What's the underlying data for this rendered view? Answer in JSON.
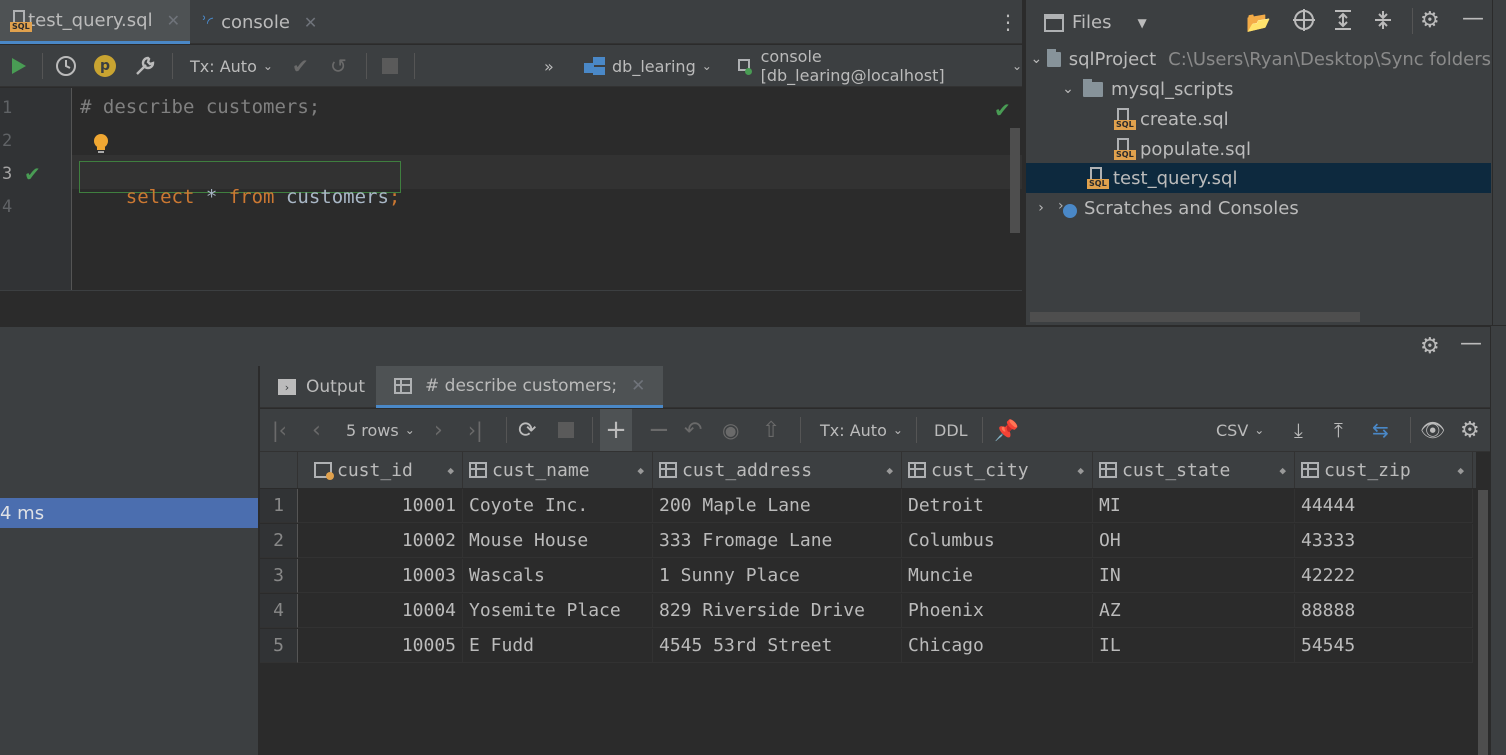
{
  "editor_tabs": [
    {
      "label": "test_query.sql",
      "active": true
    },
    {
      "label": "console",
      "active": false
    }
  ],
  "editor_toolbar": {
    "tx_mode": "Tx: Auto",
    "schema": "db_learing",
    "console": "console [db_learing@localhost]",
    "more": "»"
  },
  "editor": {
    "line_numbers": [
      "1",
      "2",
      "3",
      "4"
    ],
    "line1": "# describe customers;",
    "line3_keyword1": "select",
    "line3_star": " * ",
    "line3_keyword2": "from",
    "line3_table": " customers",
    "line3_semicolon": ";"
  },
  "project": {
    "view_label": "Files",
    "tree": {
      "root": "sqlProject",
      "root_path": "C:\\Users\\Ryan\\Desktop\\Sync folders",
      "folder": "mysql_scripts",
      "file1": "create.sql",
      "file2": "populate.sql",
      "file3": "test_query.sql",
      "scratches": "Scratches and Consoles"
    }
  },
  "services": {
    "left_item": "4 ms",
    "tabs": [
      {
        "label": "Output"
      },
      {
        "label": "# describe customers;"
      }
    ]
  },
  "result_toolbar": {
    "rows": "5 rows",
    "tx_mode": "Tx: Auto",
    "ddl": "DDL",
    "export_format": "CSV"
  },
  "grid": {
    "columns": [
      "cust_id",
      "cust_name",
      "cust_address",
      "cust_city",
      "cust_state",
      "cust_zip"
    ],
    "rows": [
      {
        "n": "1",
        "cust_id": "10001",
        "cust_name": "Coyote Inc.",
        "cust_address": "200 Maple Lane",
        "cust_city": "Detroit",
        "cust_state": "MI",
        "cust_zip": "44444"
      },
      {
        "n": "2",
        "cust_id": "10002",
        "cust_name": "Mouse House",
        "cust_address": "333 Fromage Lane",
        "cust_city": "Columbus",
        "cust_state": "OH",
        "cust_zip": "43333"
      },
      {
        "n": "3",
        "cust_id": "10003",
        "cust_name": "Wascals",
        "cust_address": "1 Sunny Place",
        "cust_city": "Muncie",
        "cust_state": "IN",
        "cust_zip": "42222"
      },
      {
        "n": "4",
        "cust_id": "10004",
        "cust_name": "Yosemite Place",
        "cust_address": "829 Riverside Drive",
        "cust_city": "Phoenix",
        "cust_state": "AZ",
        "cust_zip": "88888"
      },
      {
        "n": "5",
        "cust_id": "10005",
        "cust_name": "E Fudd",
        "cust_address": "4545 53rd Street",
        "cust_city": "Chicago",
        "cust_state": "IL",
        "cust_zip": "54545"
      }
    ]
  },
  "colors": {
    "accent": "#4a88c7",
    "keyword": "#cc7832",
    "comment": "#808080",
    "success": "#499c54",
    "selection": "#4b6eaf"
  }
}
